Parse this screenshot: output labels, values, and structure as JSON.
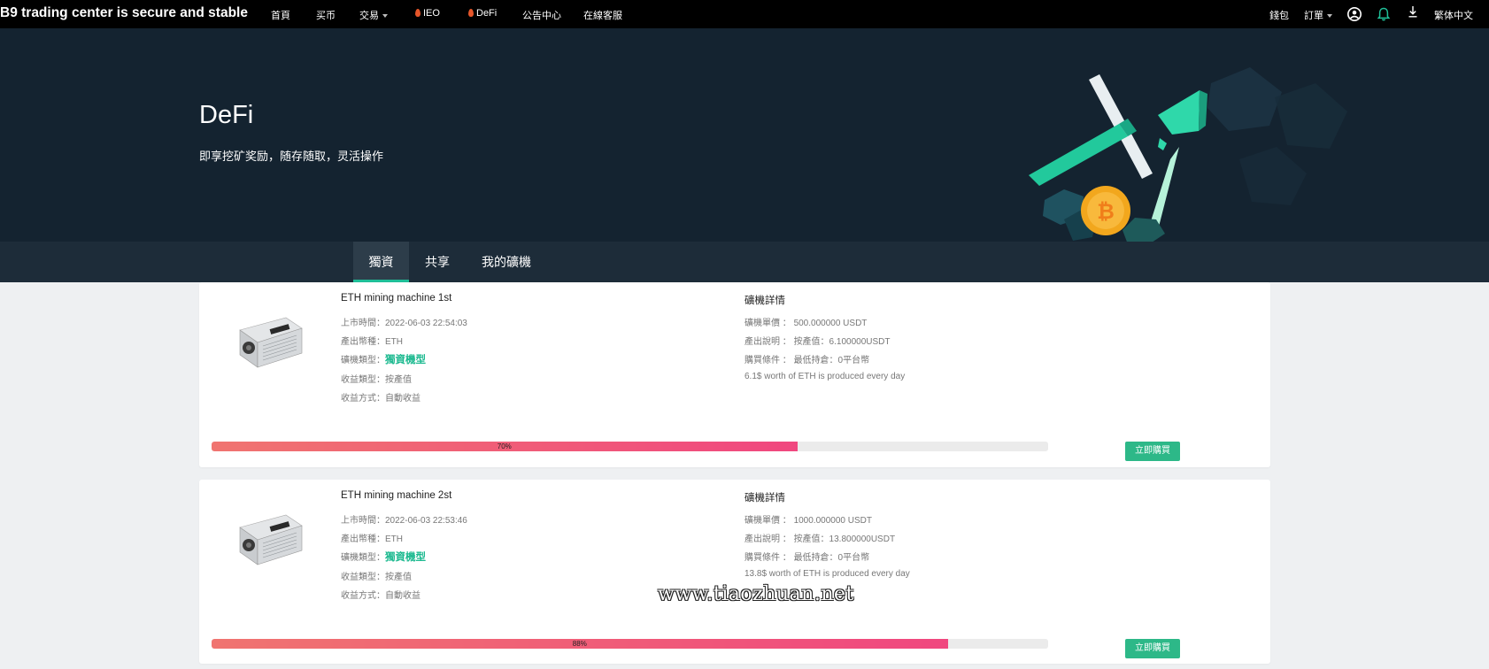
{
  "nav": {
    "brand": "B9 trading center is secure and stable",
    "items": [
      "首頁",
      "买币",
      "交易",
      "IEO",
      "DeFi",
      "公告中心",
      "在線客服"
    ],
    "right": {
      "wallet": "錢包",
      "orders": "訂單",
      "language": "繁体中文"
    },
    "icons": [
      "user-icon",
      "bell-icon",
      "download-icon"
    ]
  },
  "hero": {
    "title": "DeFi",
    "subtitle": "即享挖矿奖励，随存随取，灵活操作"
  },
  "tabs": [
    "獨資",
    "共享",
    "我的礦機"
  ],
  "labels": {
    "listed": "上市時間：",
    "coin": "產出幣種：",
    "type": "礦機類型：",
    "income_type": "收益類型：",
    "income_mode": "收益方式：",
    "detail_title": "礦機詳情",
    "price": "礦機單價 ：",
    "output": "產出說明 ：",
    "condition": "購買條件 ：",
    "buy": "立即購買"
  },
  "machines": [
    {
      "name": "ETH mining machine 1st",
      "listed": "2022-06-03 22:54:03",
      "coin": "ETH",
      "type": "獨資機型",
      "income_type": "按產值",
      "income_mode": "自動收益",
      "price": "500.000000 USDT",
      "output": "按產值：6.100000USDT",
      "condition": "最低持倉：0平台幣",
      "note": "6.1$ worth of ETH is produced every day",
      "progress": 70,
      "progress_label": "70%"
    },
    {
      "name": "ETH mining machine 2st",
      "listed": "2022-06-03 22:53:46",
      "coin": "ETH",
      "type": "獨資機型",
      "income_type": "按產值",
      "income_mode": "自動收益",
      "price": "1000.000000 USDT",
      "output": "按產值：13.800000USDT",
      "condition": "最低持倉：0平台幣",
      "note": "13.8$ worth of ETH is produced every day",
      "progress": 88,
      "progress_label": "88%"
    }
  ],
  "watermark": "www.tiaozhuan.net",
  "colors": {
    "accent": "#1fbf98",
    "button": "#2db888",
    "hero_bg": "#142330",
    "nav_bg": "#000000"
  }
}
